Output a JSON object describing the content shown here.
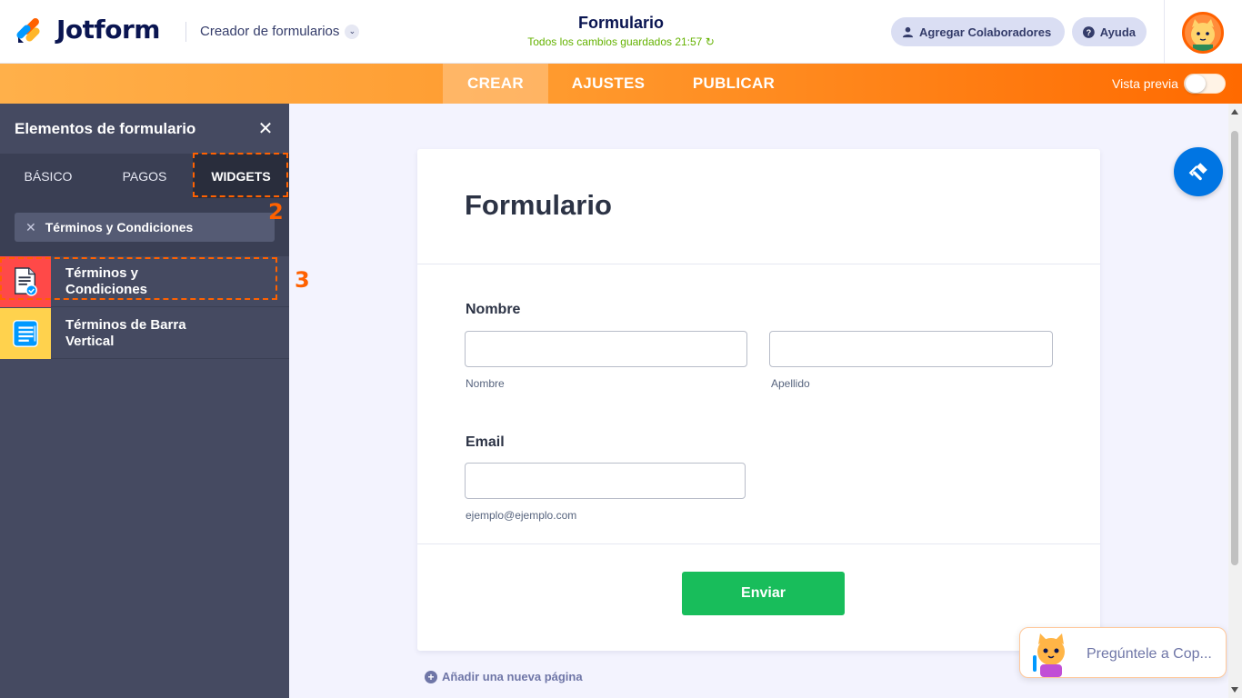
{
  "header": {
    "logo_text": "Jotform",
    "builder_menu": "Creador de formularios",
    "form_title": "Formulario",
    "save_status": "Todos los cambios guardados 21:57 ↻",
    "collaborators_button": "Agregar Colaboradores",
    "help_button": "Ayuda"
  },
  "nav": {
    "tabs": [
      "CREAR",
      "AJUSTES",
      "PUBLICAR"
    ],
    "active_tab": "CREAR",
    "preview_label": "Vista previa",
    "preview_enabled": false
  },
  "sidebar": {
    "title": "Elementos de formulario",
    "tabs": [
      "BÁSICO",
      "PAGOS",
      "WIDGETS"
    ],
    "active_tab": "WIDGETS",
    "search_value": "Términos y Condiciones",
    "items": [
      {
        "label": "Términos y Condiciones",
        "icon": "terms-document-icon"
      },
      {
        "label": "Términos de Barra Vertical",
        "icon": "vertical-list-icon"
      }
    ],
    "annotations": [
      "2",
      "3"
    ]
  },
  "form": {
    "title": "Formulario",
    "name_label": "Nombre",
    "first_name_sublabel": "Nombre",
    "last_name_sublabel": "Apellido",
    "email_label": "Email",
    "email_sublabel": "ejemplo@ejemplo.com",
    "submit_label": "Enviar",
    "add_page": "Añadir una nueva página"
  },
  "copilot": {
    "text": "Pregúntele a Cop..."
  },
  "colors": {
    "accent_orange": "#ff6100",
    "submit_green": "#18bd5b",
    "fab_blue": "#0075e3",
    "sidebar_bg": "#454a61"
  }
}
